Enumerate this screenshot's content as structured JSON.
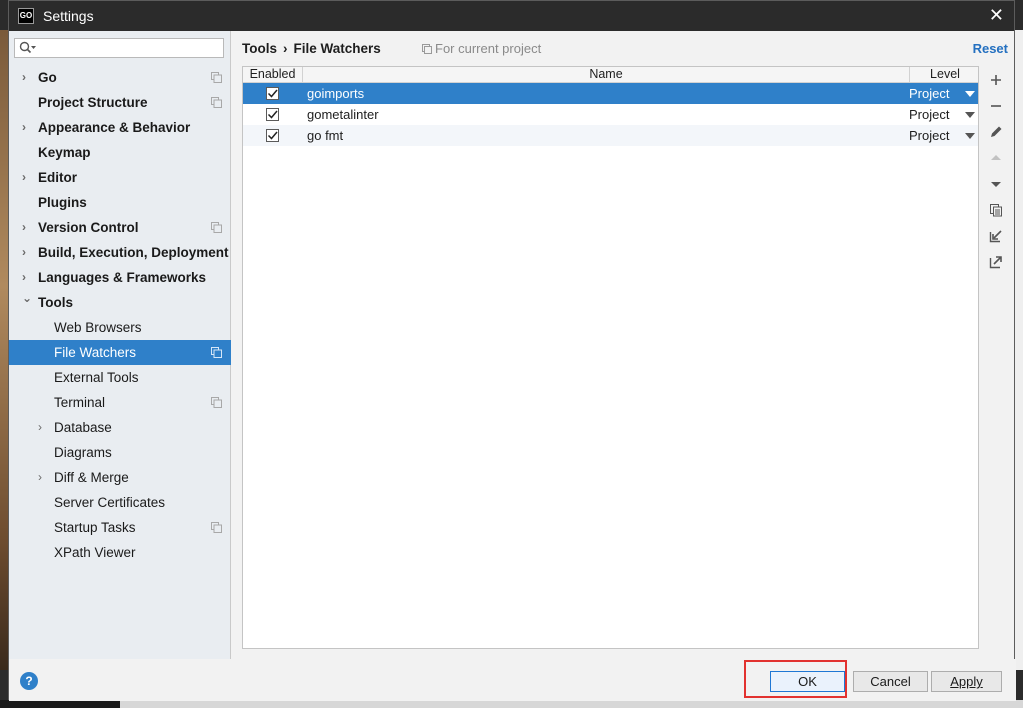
{
  "window": {
    "title": "Settings",
    "app_icon_text": "GO"
  },
  "sidebar": {
    "search_value": "",
    "items": [
      {
        "label": "Go",
        "expandable": true,
        "bold": true,
        "project_icon": true
      },
      {
        "label": "Project Structure",
        "expandable": false,
        "bold": true,
        "project_icon": true
      },
      {
        "label": "Appearance & Behavior",
        "expandable": true,
        "bold": true,
        "project_icon": false
      },
      {
        "label": "Keymap",
        "expandable": false,
        "bold": true,
        "project_icon": false
      },
      {
        "label": "Editor",
        "expandable": true,
        "bold": true,
        "project_icon": false
      },
      {
        "label": "Plugins",
        "expandable": false,
        "bold": true,
        "project_icon": false
      },
      {
        "label": "Version Control",
        "expandable": true,
        "bold": true,
        "project_icon": true
      },
      {
        "label": "Build, Execution, Deployment",
        "expandable": true,
        "bold": true,
        "project_icon": false
      },
      {
        "label": "Languages & Frameworks",
        "expandable": true,
        "bold": true,
        "project_icon": false
      },
      {
        "label": "Tools",
        "expandable": true,
        "expanded": true,
        "bold": true,
        "project_icon": false
      },
      {
        "label": "Web Browsers",
        "child": true,
        "project_icon": false
      },
      {
        "label": "File Watchers",
        "child": true,
        "selected": true,
        "project_icon": true
      },
      {
        "label": "External Tools",
        "child": true,
        "project_icon": false
      },
      {
        "label": "Terminal",
        "child": true,
        "project_icon": true
      },
      {
        "label": "Database",
        "child": true,
        "expandable": true,
        "project_icon": false
      },
      {
        "label": "Diagrams",
        "child": true,
        "project_icon": false
      },
      {
        "label": "Diff & Merge",
        "child": true,
        "expandable": true,
        "project_icon": false
      },
      {
        "label": "Server Certificates",
        "child": true,
        "project_icon": false
      },
      {
        "label": "Startup Tasks",
        "child": true,
        "project_icon": true
      },
      {
        "label": "XPath Viewer",
        "child": true,
        "project_icon": false
      }
    ]
  },
  "main": {
    "breadcrumb": [
      "Tools",
      "File Watchers"
    ],
    "breadcrumb_sep": "›",
    "scope_note": "For current project",
    "reset_label": "Reset",
    "table": {
      "columns": [
        "Enabled",
        "Name",
        "Level"
      ],
      "rows": [
        {
          "enabled": true,
          "name": "goimports",
          "level": "Project",
          "selected": true
        },
        {
          "enabled": true,
          "name": "gometalinter",
          "level": "Project",
          "selected": false
        },
        {
          "enabled": true,
          "name": "go fmt",
          "level": "Project",
          "selected": false
        }
      ]
    },
    "toolbar": [
      "add-icon",
      "remove-icon",
      "edit-icon",
      "move-up-icon",
      "move-down-icon",
      "copy-icon",
      "import-icon",
      "export-icon"
    ]
  },
  "footer": {
    "help_label": "?",
    "ok_label": "OK",
    "cancel_label": "Cancel",
    "apply_label": "Apply"
  },
  "colors": {
    "selection": "#2f80c9",
    "link": "#2470c0",
    "highlight_box": "#e2322f"
  }
}
